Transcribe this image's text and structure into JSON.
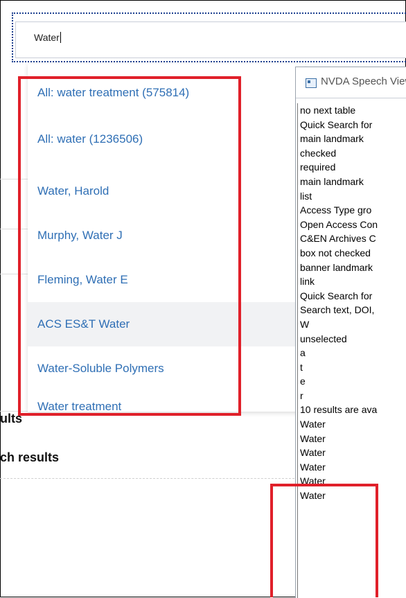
{
  "search": {
    "value": "Water"
  },
  "background": {
    "results_fragment": "ults",
    "search_results_fragment": "ch results"
  },
  "suggestions": [
    "All: water treatment (575814)",
    "All: water (1236506)",
    "Water, Harold",
    "Murphy, Water J",
    "Fleming, Water E",
    "ACS ES&T Water",
    "Water-Soluble Polymers",
    "Water treatment"
  ],
  "nvda": {
    "title": "NVDA Speech Viewer",
    "lines": [
      "no next table",
      "Quick Search  for",
      "main landmark",
      "checked",
      "required",
      "main landmark",
      "list",
      "Access Type  gro",
      "Open Access Con",
      "C&EN Archives C",
      "box  not checked",
      "banner landmark",
      "link",
      "Quick Search  for",
      "Search text, DOI,",
      "W",
      " unselected",
      "a",
      "t",
      "e",
      "r",
      "10 results are ava",
      "Water",
      "Water",
      "Water",
      "Water",
      "Water",
      "Water"
    ]
  },
  "highlight_color": "#e0202a",
  "link_color": "#2f6fb5"
}
